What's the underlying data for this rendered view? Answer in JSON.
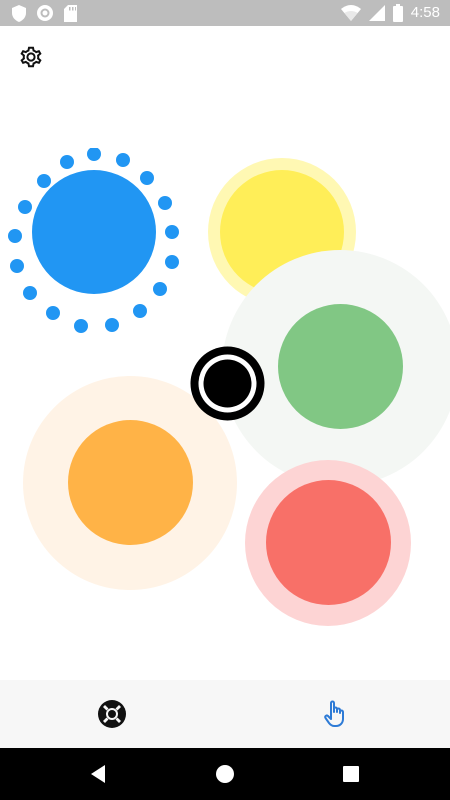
{
  "status_bar": {
    "time": "4:58",
    "icons": [
      "shield-icon",
      "circle-notification-icon",
      "sd-card-icon",
      "wifi-icon",
      "cell-signal-icon",
      "battery-icon"
    ]
  },
  "app": {
    "settings_icon": "gear-icon"
  },
  "circles": [
    {
      "id": "blue",
      "color": "#2196f3",
      "state": "selected"
    },
    {
      "id": "yellow",
      "color": "#ffeb3b",
      "halo": "#fff59d"
    },
    {
      "id": "green",
      "color": "#81c784",
      "halo": "#f5f7f5"
    },
    {
      "id": "orange",
      "color": "#ffb74d",
      "halo": "#fff3e6"
    },
    {
      "id": "red",
      "color": "#f87171",
      "halo": "#fdd3d3"
    },
    {
      "id": "center-target",
      "color": "#000000"
    }
  ],
  "toolbar": {
    "left_icon": "lifebuoy-icon",
    "right_icon": "tap-hand-icon",
    "accent": "#2e7bd6"
  },
  "nav": {
    "back": "back-icon",
    "home": "home-icon",
    "recents": "recents-icon"
  }
}
